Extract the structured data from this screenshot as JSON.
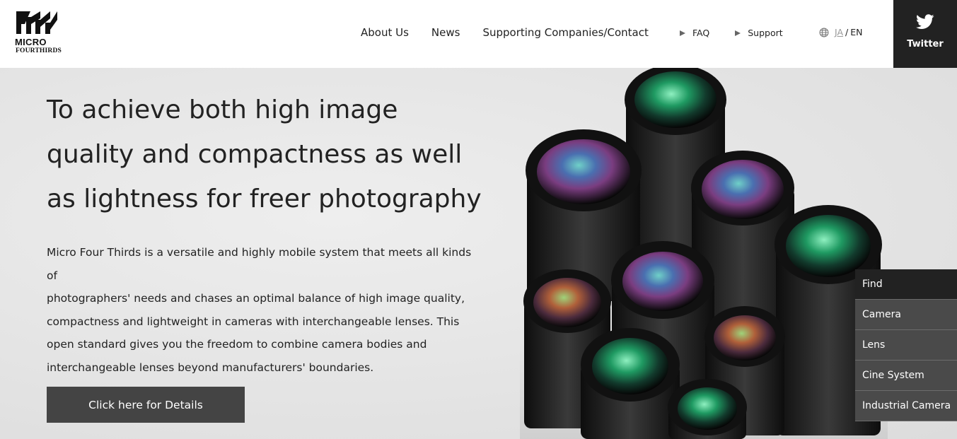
{
  "logo": {
    "line1": "MICRO",
    "line2": "FOURTHIRDS"
  },
  "nav": {
    "main": [
      "About Us",
      "News",
      "Supporting Companies/Contact"
    ],
    "sub": [
      "FAQ",
      "Support"
    ],
    "lang_ja": "JA",
    "lang_sep": "/",
    "lang_en": "EN"
  },
  "twitter": {
    "label": "Twitter",
    "icon": "twitter-bird-icon"
  },
  "hero": {
    "title_lines": [
      "To achieve both high image",
      "quality and compactness as well",
      "as lightness for freer photography"
    ],
    "desc_lines": [
      "Micro Four Thirds is a versatile and highly mobile system that meets all kinds of",
      "photographers' needs and chases an optimal balance of high image quality,",
      "compactness and lightweight in cameras with interchangeable lenses. This",
      "open standard gives you the freedom to combine camera bodies and",
      "interchangeable lenses beyond manufacturers' boundaries."
    ],
    "button": "Click here for Details"
  },
  "find_menu": {
    "title": "Find",
    "items": [
      "Camera",
      "Lens",
      "Cine System",
      "Industrial Camera"
    ]
  },
  "colors": {
    "dark": "#222222",
    "button": "#444444",
    "menu_item": "#4a4a4a",
    "accent_lens": "#2f9b6a"
  }
}
